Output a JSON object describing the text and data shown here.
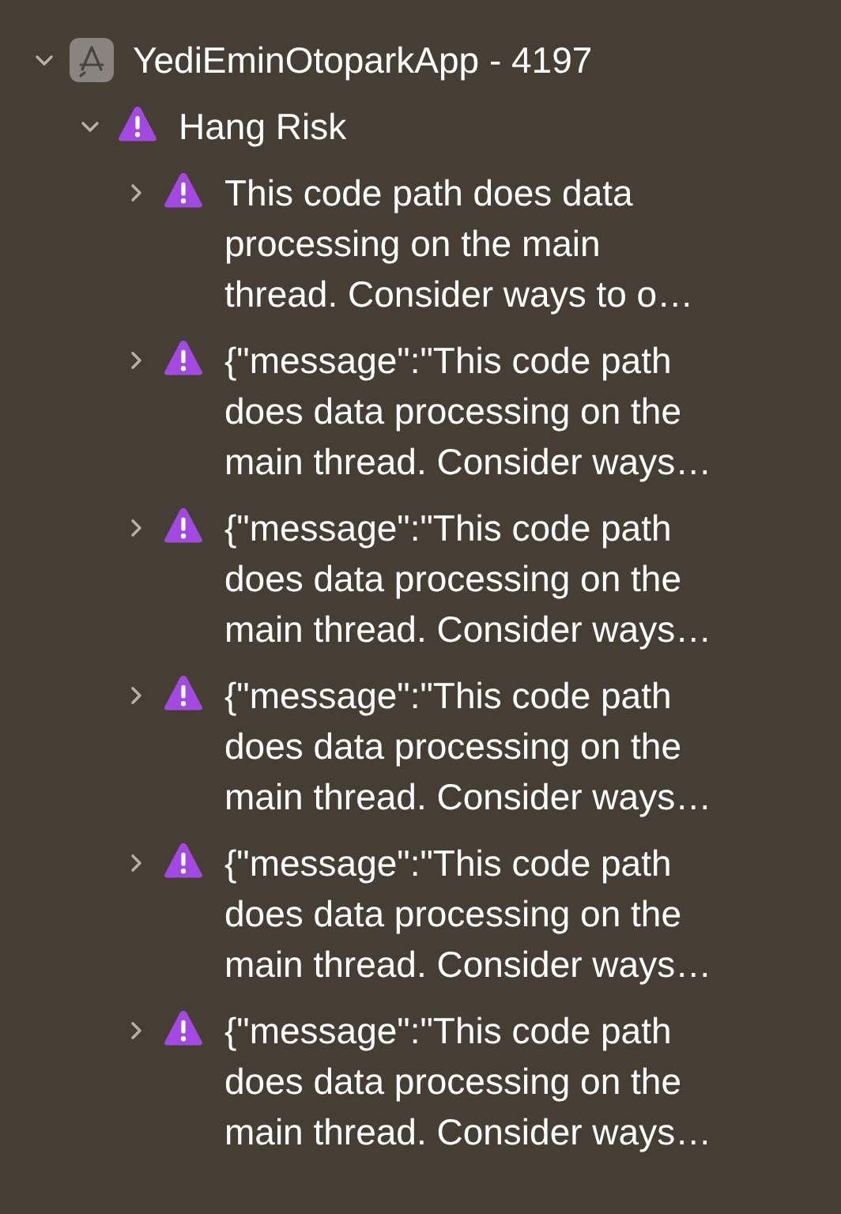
{
  "tree": [
    {
      "kind": "app",
      "label": "YediEminOtoparkApp - 4197",
      "expanded": true,
      "children": [
        {
          "kind": "warning",
          "label": "Hang Risk",
          "expanded": true,
          "children": [
            {
              "kind": "warning",
              "label": "This code path does data\nprocessing on the main\nthread. Consider ways to o…",
              "expanded": false
            },
            {
              "kind": "warning",
              "label": "{\"message\":\"This code path\ndoes data processing on the\nmain thread. Consider ways…",
              "expanded": false
            },
            {
              "kind": "warning",
              "label": "{\"message\":\"This code path\ndoes data processing on the\nmain thread. Consider ways…",
              "expanded": false
            },
            {
              "kind": "warning",
              "label": "{\"message\":\"This code path\ndoes data processing on the\nmain thread. Consider ways…",
              "expanded": false
            },
            {
              "kind": "warning",
              "label": "{\"message\":\"This code path\ndoes data processing on the\nmain thread. Consider ways…",
              "expanded": false
            },
            {
              "kind": "warning",
              "label": "{\"message\":\"This code path\ndoes data processing on the\nmain thread. Consider ways…",
              "expanded": false
            }
          ]
        }
      ]
    }
  ]
}
